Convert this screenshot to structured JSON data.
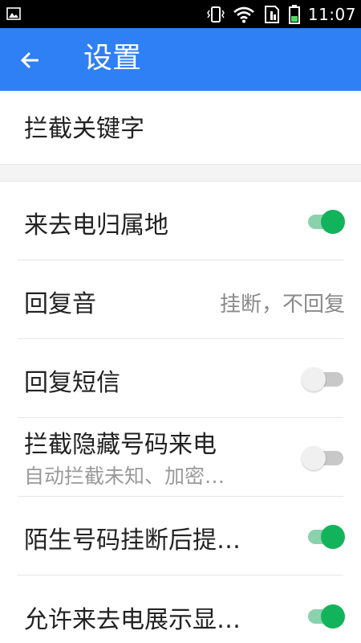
{
  "status_bar": {
    "time": "11:07",
    "left_icon": "image-notification-icon",
    "icons": [
      "vibrate-icon",
      "wifi-icon",
      "sim-icon",
      "battery-icon"
    ]
  },
  "app_bar": {
    "title": "设置",
    "back_icon": "back-arrow-icon",
    "color": "#2f7ff5"
  },
  "settings": {
    "block_keywords": {
      "label": "拦截关键字"
    },
    "caller_location": {
      "label": "来去电归属地",
      "switch_on": true
    },
    "reply_tone": {
      "label": "回复音",
      "value": "挂断，不回复"
    },
    "reply_sms": {
      "label": "回复短信",
      "switch_on": false
    },
    "block_hidden": {
      "label": "拦截隐藏号码来电",
      "sub": "自动拦截未知、加密…",
      "switch_on": false
    },
    "stranger_prompt": {
      "label": "陌生号码挂断后提…",
      "switch_on": true
    },
    "allow_display": {
      "label": "允许来去电展示显…",
      "switch_on": true
    }
  },
  "colors": {
    "switch_on_thumb": "#12b45b",
    "switch_on_track": "#8ad2ad",
    "switch_off_track": "#c8c8c8"
  }
}
